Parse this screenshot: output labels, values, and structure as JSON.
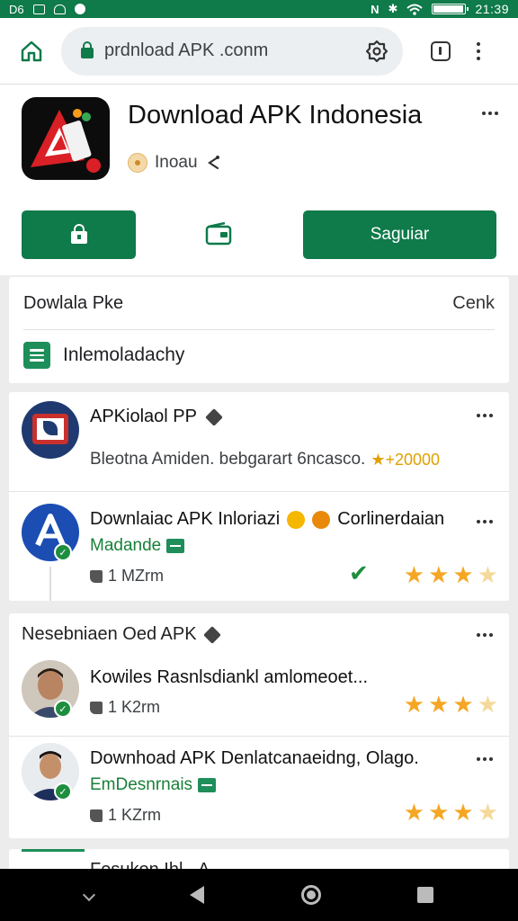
{
  "status_bar": {
    "left_label": "D6",
    "time": "21:39",
    "battery_level": 0.95,
    "status_color": "#0f7a4a"
  },
  "browser": {
    "url": "prdnload APK .conm",
    "home_icon": "home-icon",
    "lock_icon": "lock-icon",
    "tabs_icon": "tabs-icon",
    "menu_icon": "more-vert-icon"
  },
  "app": {
    "title": "Download APK Indonesia",
    "developer": "Inoau",
    "save_button": "Saguiar",
    "accent_color": "#0f7a4a"
  },
  "download_section": {
    "title": "Dowlala Pke",
    "action": "Cenk",
    "subtitle": "Inlemoladachy"
  },
  "list_card1": {
    "items": [
      {
        "title": "APKiolaol PP",
        "description": "Bleotna Amiden. bebgarart 6ncasco.",
        "rating": "★+20000"
      },
      {
        "title": "Downlaiac APK Inloriazi",
        "suffix": "Corlinerdaian",
        "subtitle": "Madande",
        "meta": "1 MZrm",
        "rating": 3.5
      }
    ]
  },
  "list_card2": {
    "section_title": "Nesebniaen Oed APK",
    "items": [
      {
        "title": "Kowiles Rasnlsdiankl amlomeoet...",
        "meta": "1 K2rm",
        "rating": 3.5
      },
      {
        "title": "Downhoad APK Denlatcanaeidng, Olago.",
        "subtitle": "EmDesnrnais",
        "meta": "1 KZrm",
        "rating": 3.5
      }
    ]
  },
  "list_card3": {
    "title": "Fesukon Ihl...A"
  },
  "nav": {
    "down_icon": "chevron-down-icon",
    "back_icon": "back-icon",
    "home_icon": "home-circle-icon",
    "recent_icon": "recent-apps-icon"
  }
}
